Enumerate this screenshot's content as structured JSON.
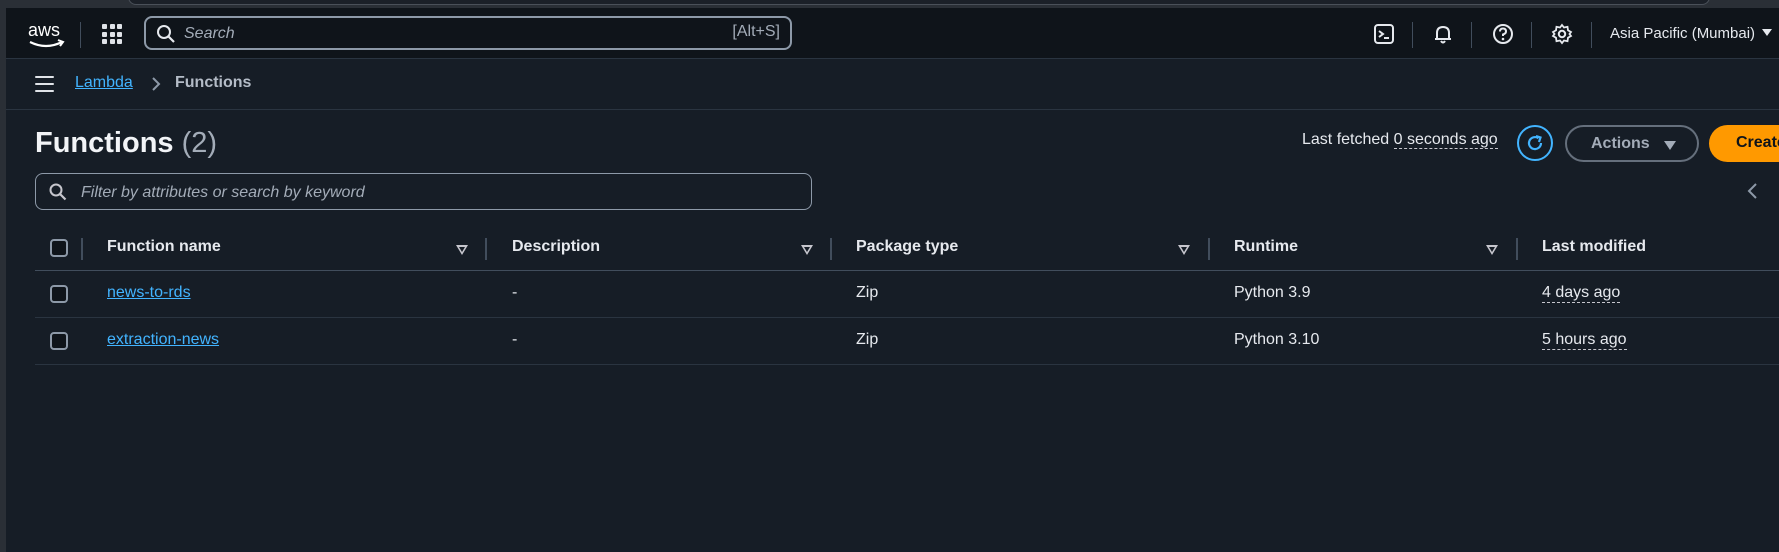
{
  "nav": {
    "logo_text": "aws",
    "search_placeholder": "Search",
    "search_shortcut": "[Alt+S]",
    "region": "Asia Pacific (Mumbai)"
  },
  "breadcrumb": {
    "service": "Lambda",
    "current": "Functions"
  },
  "header": {
    "title": "Functions",
    "count": "(2)",
    "last_fetched_label": "Last fetched",
    "last_fetched_value": "0 seconds ago",
    "actions_label": "Actions",
    "create_label": "Create function"
  },
  "filter": {
    "placeholder": "Filter by attributes or search by keyword"
  },
  "table": {
    "columns": [
      "Function name",
      "Description",
      "Package type",
      "Runtime",
      "Last modified"
    ],
    "rows": [
      {
        "name": "news-to-rds",
        "description": "-",
        "package_type": "Zip",
        "runtime": "Python 3.9",
        "last_modified": "4 days ago"
      },
      {
        "name": "extraction-news",
        "description": "-",
        "package_type": "Zip",
        "runtime": "Python 3.10",
        "last_modified": "5 hours ago"
      }
    ]
  },
  "colors": {
    "background": "#161d26",
    "nav_background": "#0f141a",
    "link": "#42b4ff",
    "primary_button": "#ff9900"
  }
}
